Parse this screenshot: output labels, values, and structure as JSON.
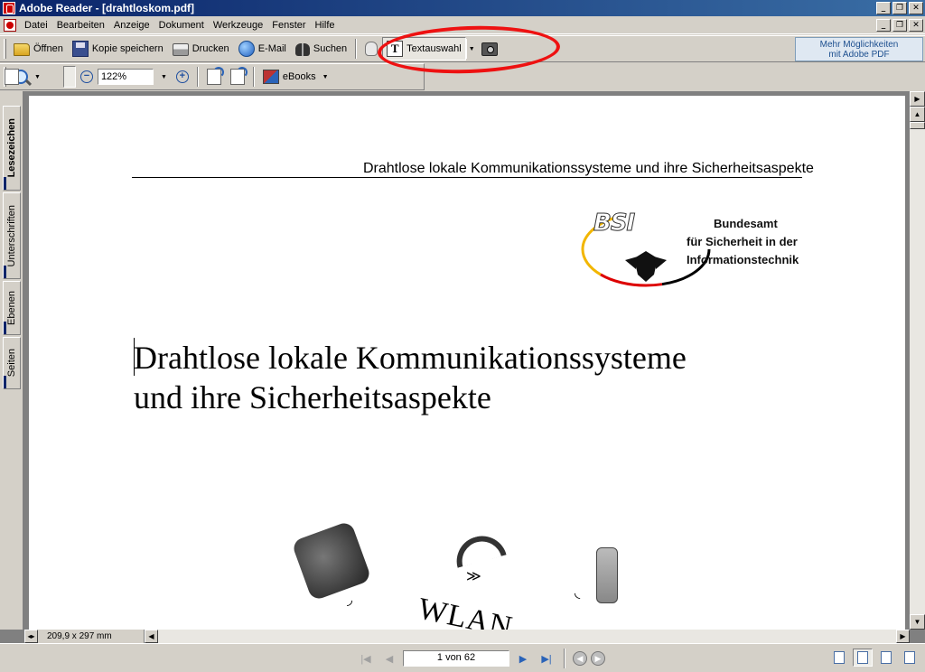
{
  "window": {
    "title": "Adobe Reader - [drahtloskom.pdf]",
    "minimize": "_",
    "maximize": "❐",
    "close": "✕"
  },
  "menu": {
    "items": [
      {
        "label": "Datei"
      },
      {
        "label": "Bearbeiten"
      },
      {
        "label": "Anzeige"
      },
      {
        "label": "Dokument"
      },
      {
        "label": "Werkzeuge"
      },
      {
        "label": "Fenster"
      },
      {
        "label": "Hilfe"
      }
    ]
  },
  "toolbar": {
    "open": "Öffnen",
    "save_copy": "Kopie speichern",
    "print": "Drucken",
    "email": "E-Mail",
    "search": "Suchen",
    "text_select": "Textauswahl",
    "promo_line1": "Mehr Möglichkeiten",
    "promo_line2": "mit Adobe PDF"
  },
  "toolbar2": {
    "zoom_value": "122%",
    "ebooks": "eBooks",
    "zoom_out": "−",
    "zoom_in": "+"
  },
  "nav_tabs": [
    {
      "label": "Lesezeichen",
      "active": true
    },
    {
      "label": "Unterschriften",
      "active": false
    },
    {
      "label": "Ebenen",
      "active": false
    },
    {
      "label": "Seiten",
      "active": false
    }
  ],
  "document": {
    "running_head": "Drahtlose lokale Kommunikationssysteme und ihre Sicherheitsaspekte",
    "logo_letters": "BSI",
    "logo_line1": "Bundesamt",
    "logo_line2": "für Sicherheit in der",
    "logo_line3": "Informationstechnik",
    "title_line1": "Drahtlose lokale Kommunikationssysteme",
    "title_line2": "und ihre Sicherheitsaspekte",
    "wlan_partial": "WLAN"
  },
  "status": {
    "page_size": "209,9 x 297 mm",
    "page_indicator": "1 von 62"
  }
}
